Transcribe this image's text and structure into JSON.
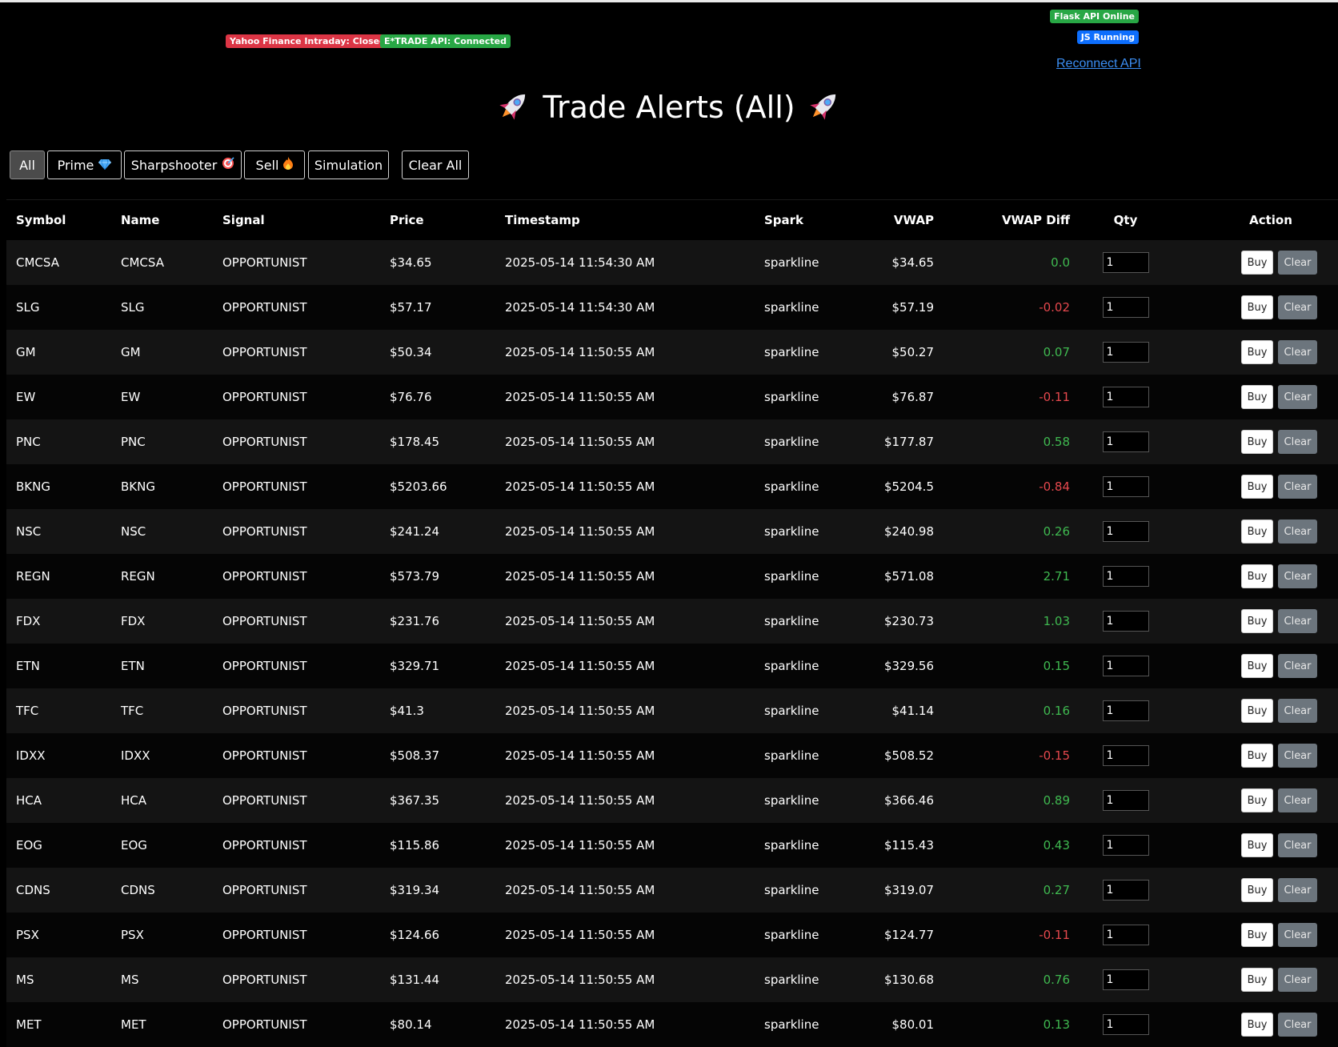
{
  "status": {
    "yahoo": "Yahoo Finance Intraday: Closed",
    "etrade": "E*TRADE API: Connected",
    "flask": "Flask API Online",
    "js": "JS Running",
    "reconnect": "Reconnect API"
  },
  "title": {
    "text": "Trade Alerts (All)",
    "icon_left": "rocket-icon",
    "icon_right": "rocket-icon"
  },
  "filters": {
    "all": "All",
    "prime": "Prime",
    "sharpshooter": "Sharpshooter",
    "sell": "Sell",
    "simulation": "Simulation",
    "clear_all": "Clear All",
    "icons": {
      "prime": "gem-icon",
      "sharpshooter": "target-icon",
      "sell": "fire-icon"
    }
  },
  "colors": {
    "positive": "#3fb950",
    "negative": "#e5484d",
    "badge_red": "#dc3545",
    "badge_green": "#28a745",
    "badge_blue": "#0d6efd"
  },
  "table": {
    "headers": [
      "Symbol",
      "Name",
      "Signal",
      "Price",
      "Timestamp",
      "Spark",
      "VWAP",
      "VWAP Diff",
      "Qty",
      "Action"
    ],
    "buy_label": "Buy",
    "clear_label": "Clear",
    "rows": [
      {
        "symbol": "CMCSA",
        "name": "CMCSA",
        "signal": "OPPORTUNIST",
        "price": "$34.65",
        "timestamp": "2025-05-14 11:54:30 AM",
        "spark": "sparkline",
        "vwap": "$34.65",
        "diff": "0.0",
        "qty": "1"
      },
      {
        "symbol": "SLG",
        "name": "SLG",
        "signal": "OPPORTUNIST",
        "price": "$57.17",
        "timestamp": "2025-05-14 11:54:30 AM",
        "spark": "sparkline",
        "vwap": "$57.19",
        "diff": "-0.02",
        "qty": "1"
      },
      {
        "symbol": "GM",
        "name": "GM",
        "signal": "OPPORTUNIST",
        "price": "$50.34",
        "timestamp": "2025-05-14 11:50:55 AM",
        "spark": "sparkline",
        "vwap": "$50.27",
        "diff": "0.07",
        "qty": "1"
      },
      {
        "symbol": "EW",
        "name": "EW",
        "signal": "OPPORTUNIST",
        "price": "$76.76",
        "timestamp": "2025-05-14 11:50:55 AM",
        "spark": "sparkline",
        "vwap": "$76.87",
        "diff": "-0.11",
        "qty": "1"
      },
      {
        "symbol": "PNC",
        "name": "PNC",
        "signal": "OPPORTUNIST",
        "price": "$178.45",
        "timestamp": "2025-05-14 11:50:55 AM",
        "spark": "sparkline",
        "vwap": "$177.87",
        "diff": "0.58",
        "qty": "1"
      },
      {
        "symbol": "BKNG",
        "name": "BKNG",
        "signal": "OPPORTUNIST",
        "price": "$5203.66",
        "timestamp": "2025-05-14 11:50:55 AM",
        "spark": "sparkline",
        "vwap": "$5204.5",
        "diff": "-0.84",
        "qty": "1"
      },
      {
        "symbol": "NSC",
        "name": "NSC",
        "signal": "OPPORTUNIST",
        "price": "$241.24",
        "timestamp": "2025-05-14 11:50:55 AM",
        "spark": "sparkline",
        "vwap": "$240.98",
        "diff": "0.26",
        "qty": "1"
      },
      {
        "symbol": "REGN",
        "name": "REGN",
        "signal": "OPPORTUNIST",
        "price": "$573.79",
        "timestamp": "2025-05-14 11:50:55 AM",
        "spark": "sparkline",
        "vwap": "$571.08",
        "diff": "2.71",
        "qty": "1"
      },
      {
        "symbol": "FDX",
        "name": "FDX",
        "signal": "OPPORTUNIST",
        "price": "$231.76",
        "timestamp": "2025-05-14 11:50:55 AM",
        "spark": "sparkline",
        "vwap": "$230.73",
        "diff": "1.03",
        "qty": "1"
      },
      {
        "symbol": "ETN",
        "name": "ETN",
        "signal": "OPPORTUNIST",
        "price": "$329.71",
        "timestamp": "2025-05-14 11:50:55 AM",
        "spark": "sparkline",
        "vwap": "$329.56",
        "diff": "0.15",
        "qty": "1"
      },
      {
        "symbol": "TFC",
        "name": "TFC",
        "signal": "OPPORTUNIST",
        "price": "$41.3",
        "timestamp": "2025-05-14 11:50:55 AM",
        "spark": "sparkline",
        "vwap": "$41.14",
        "diff": "0.16",
        "qty": "1"
      },
      {
        "symbol": "IDXX",
        "name": "IDXX",
        "signal": "OPPORTUNIST",
        "price": "$508.37",
        "timestamp": "2025-05-14 11:50:55 AM",
        "spark": "sparkline",
        "vwap": "$508.52",
        "diff": "-0.15",
        "qty": "1"
      },
      {
        "symbol": "HCA",
        "name": "HCA",
        "signal": "OPPORTUNIST",
        "price": "$367.35",
        "timestamp": "2025-05-14 11:50:55 AM",
        "spark": "sparkline",
        "vwap": "$366.46",
        "diff": "0.89",
        "qty": "1"
      },
      {
        "symbol": "EOG",
        "name": "EOG",
        "signal": "OPPORTUNIST",
        "price": "$115.86",
        "timestamp": "2025-05-14 11:50:55 AM",
        "spark": "sparkline",
        "vwap": "$115.43",
        "diff": "0.43",
        "qty": "1"
      },
      {
        "symbol": "CDNS",
        "name": "CDNS",
        "signal": "OPPORTUNIST",
        "price": "$319.34",
        "timestamp": "2025-05-14 11:50:55 AM",
        "spark": "sparkline",
        "vwap": "$319.07",
        "diff": "0.27",
        "qty": "1"
      },
      {
        "symbol": "PSX",
        "name": "PSX",
        "signal": "OPPORTUNIST",
        "price": "$124.66",
        "timestamp": "2025-05-14 11:50:55 AM",
        "spark": "sparkline",
        "vwap": "$124.77",
        "diff": "-0.11",
        "qty": "1"
      },
      {
        "symbol": "MS",
        "name": "MS",
        "signal": "OPPORTUNIST",
        "price": "$131.44",
        "timestamp": "2025-05-14 11:50:55 AM",
        "spark": "sparkline",
        "vwap": "$130.68",
        "diff": "0.76",
        "qty": "1"
      },
      {
        "symbol": "MET",
        "name": "MET",
        "signal": "OPPORTUNIST",
        "price": "$80.14",
        "timestamp": "2025-05-14 11:50:55 AM",
        "spark": "sparkline",
        "vwap": "$80.01",
        "diff": "0.13",
        "qty": "1"
      }
    ]
  }
}
